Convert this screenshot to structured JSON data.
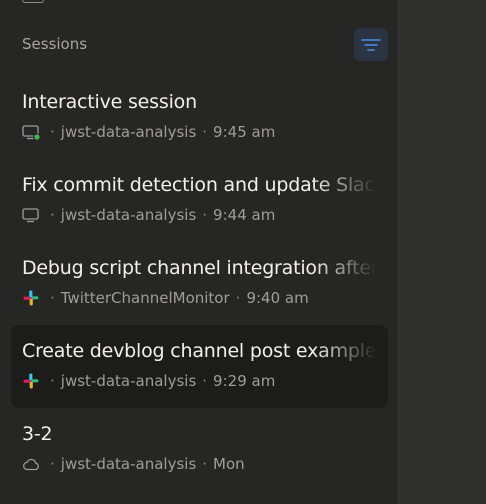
{
  "sidebar": {
    "section_title": "Sessions",
    "sessions": [
      {
        "title": "Interactive session",
        "icon": "monitor-online-icon",
        "repo": "jwst-data-analysis",
        "time": "9:45 am",
        "active": false
      },
      {
        "title": "Fix commit detection and update Slack",
        "icon": "monitor-icon",
        "repo": "jwst-data-analysis",
        "time": "9:44 am",
        "active": false
      },
      {
        "title": "Debug script channel integration after",
        "icon": "slack-icon",
        "repo": "TwitterChannelMonitor",
        "time": "9:40 am",
        "active": false
      },
      {
        "title": "Create devblog channel post example",
        "icon": "slack-icon",
        "repo": "jwst-data-analysis",
        "time": "9:29 am",
        "active": true
      },
      {
        "title": "3-2",
        "icon": "cloud-icon",
        "repo": "jwst-data-analysis",
        "time": "Mon",
        "active": false
      }
    ],
    "separator": "·"
  },
  "colors": {
    "online_dot": "#3fb950",
    "filter_accent": "#4a90e2",
    "active_bg": "#1c1c1b"
  }
}
